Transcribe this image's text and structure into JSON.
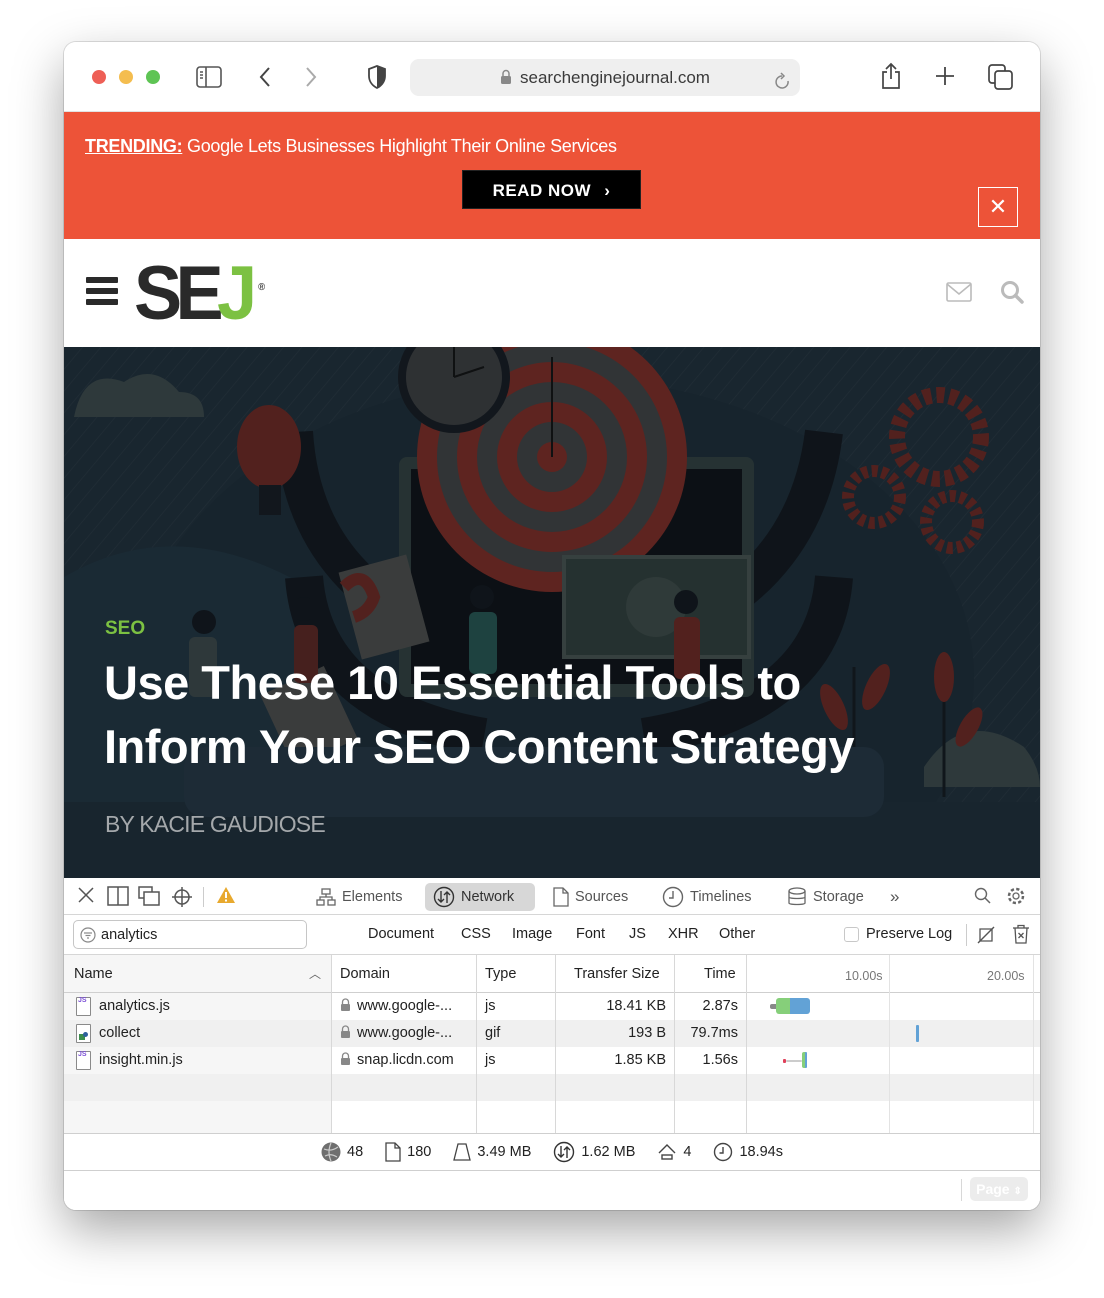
{
  "browser": {
    "url": "searchenginejournal.com",
    "icons": [
      "sidebar-icon",
      "back-icon",
      "forward-icon",
      "shield-icon",
      "lock-icon",
      "reload-icon",
      "share-icon",
      "new-tab-icon",
      "tab-overview-icon"
    ]
  },
  "banner": {
    "label": "TRENDING:",
    "headline": "Google Lets Businesses Highlight Their Online Services",
    "cta": "READ NOW",
    "cta_icon": "›",
    "close": "✕",
    "color": "#ed5338"
  },
  "site": {
    "logo_dark": "SE",
    "logo_green": "J",
    "logo_reg": "®",
    "brand_green": "#7cc142"
  },
  "article": {
    "category": "SEO",
    "title_line1": "Use These 10 Essential Tools to",
    "title_line2": "Inform Your SEO Content Strategy",
    "author": "BY KACIE GAUDIOSE"
  },
  "devtools": {
    "tabs": [
      {
        "label": "Elements",
        "active": false
      },
      {
        "label": "Network",
        "active": true
      },
      {
        "label": "Sources",
        "active": false
      },
      {
        "label": "Timelines",
        "active": false
      },
      {
        "label": "Storage",
        "active": false
      }
    ],
    "more": "»",
    "filter": {
      "value": "analytics",
      "types": [
        "Document",
        "CSS",
        "Image",
        "Font",
        "JS",
        "XHR",
        "Other"
      ],
      "preserve_log": "Preserve Log",
      "preserve_log_checked": false
    },
    "columns": [
      "Name",
      "Domain",
      "Type",
      "Transfer Size",
      "Time"
    ],
    "timeline_ticks": [
      "10.00s",
      "20.00s"
    ],
    "rows": [
      {
        "name": "analytics.js",
        "icon": "js",
        "domain": "www.google-...",
        "type": "js",
        "size": "18.41 KB",
        "time": "2.87s"
      },
      {
        "name": "collect",
        "icon": "image",
        "domain": "www.google-...",
        "type": "gif",
        "size": "193 B",
        "time": "79.7ms"
      },
      {
        "name": "insight.min.js",
        "icon": "js",
        "domain": "snap.licdn.com",
        "type": "js",
        "size": "1.85 KB",
        "time": "1.56s"
      }
    ],
    "summary": {
      "domains": "48",
      "resources": "180",
      "size": "3.49 MB",
      "transferred": "1.62 MB",
      "redirects": "4",
      "time": "18.94s"
    },
    "page_button": "Page"
  }
}
